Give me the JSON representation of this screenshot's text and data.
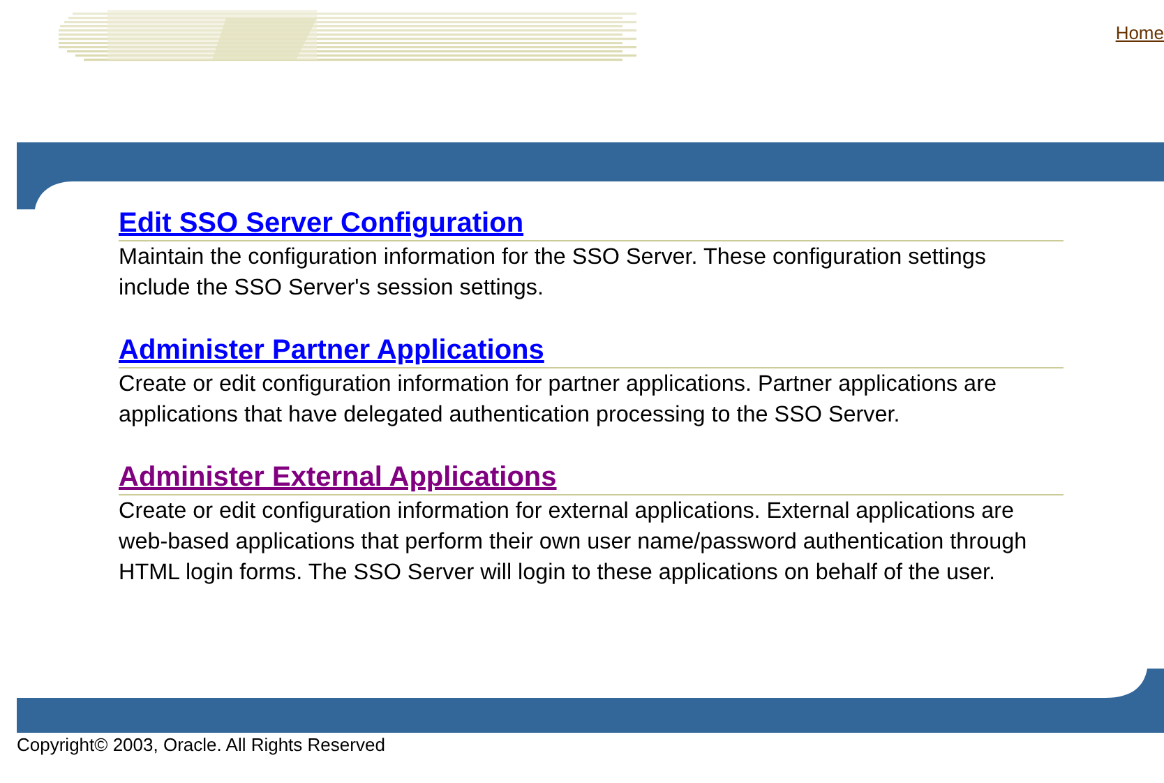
{
  "header": {
    "links": [
      {
        "label": "Home"
      }
    ]
  },
  "sections": [
    {
      "title": "Edit SSO Server Configuration",
      "visited": false,
      "description": "Maintain the configuration information for the SSO Server. These configuration settings include the SSO Server's session settings."
    },
    {
      "title": "Administer Partner Applications",
      "visited": false,
      "description": "Create or edit configuration information for partner applications. Partner applications are applications that have delegated authentication processing to the SSO Server."
    },
    {
      "title": "Administer External Applications",
      "visited": true,
      "description": "Create or edit configuration information for external applications. External applications are web-based applications that perform their own user name/password authentication through HTML login forms. The SSO Server will login to these applications on behalf of the user."
    }
  ],
  "footer": {
    "copyright": "Copyright© 2003, Oracle. All Rights Reserved"
  }
}
